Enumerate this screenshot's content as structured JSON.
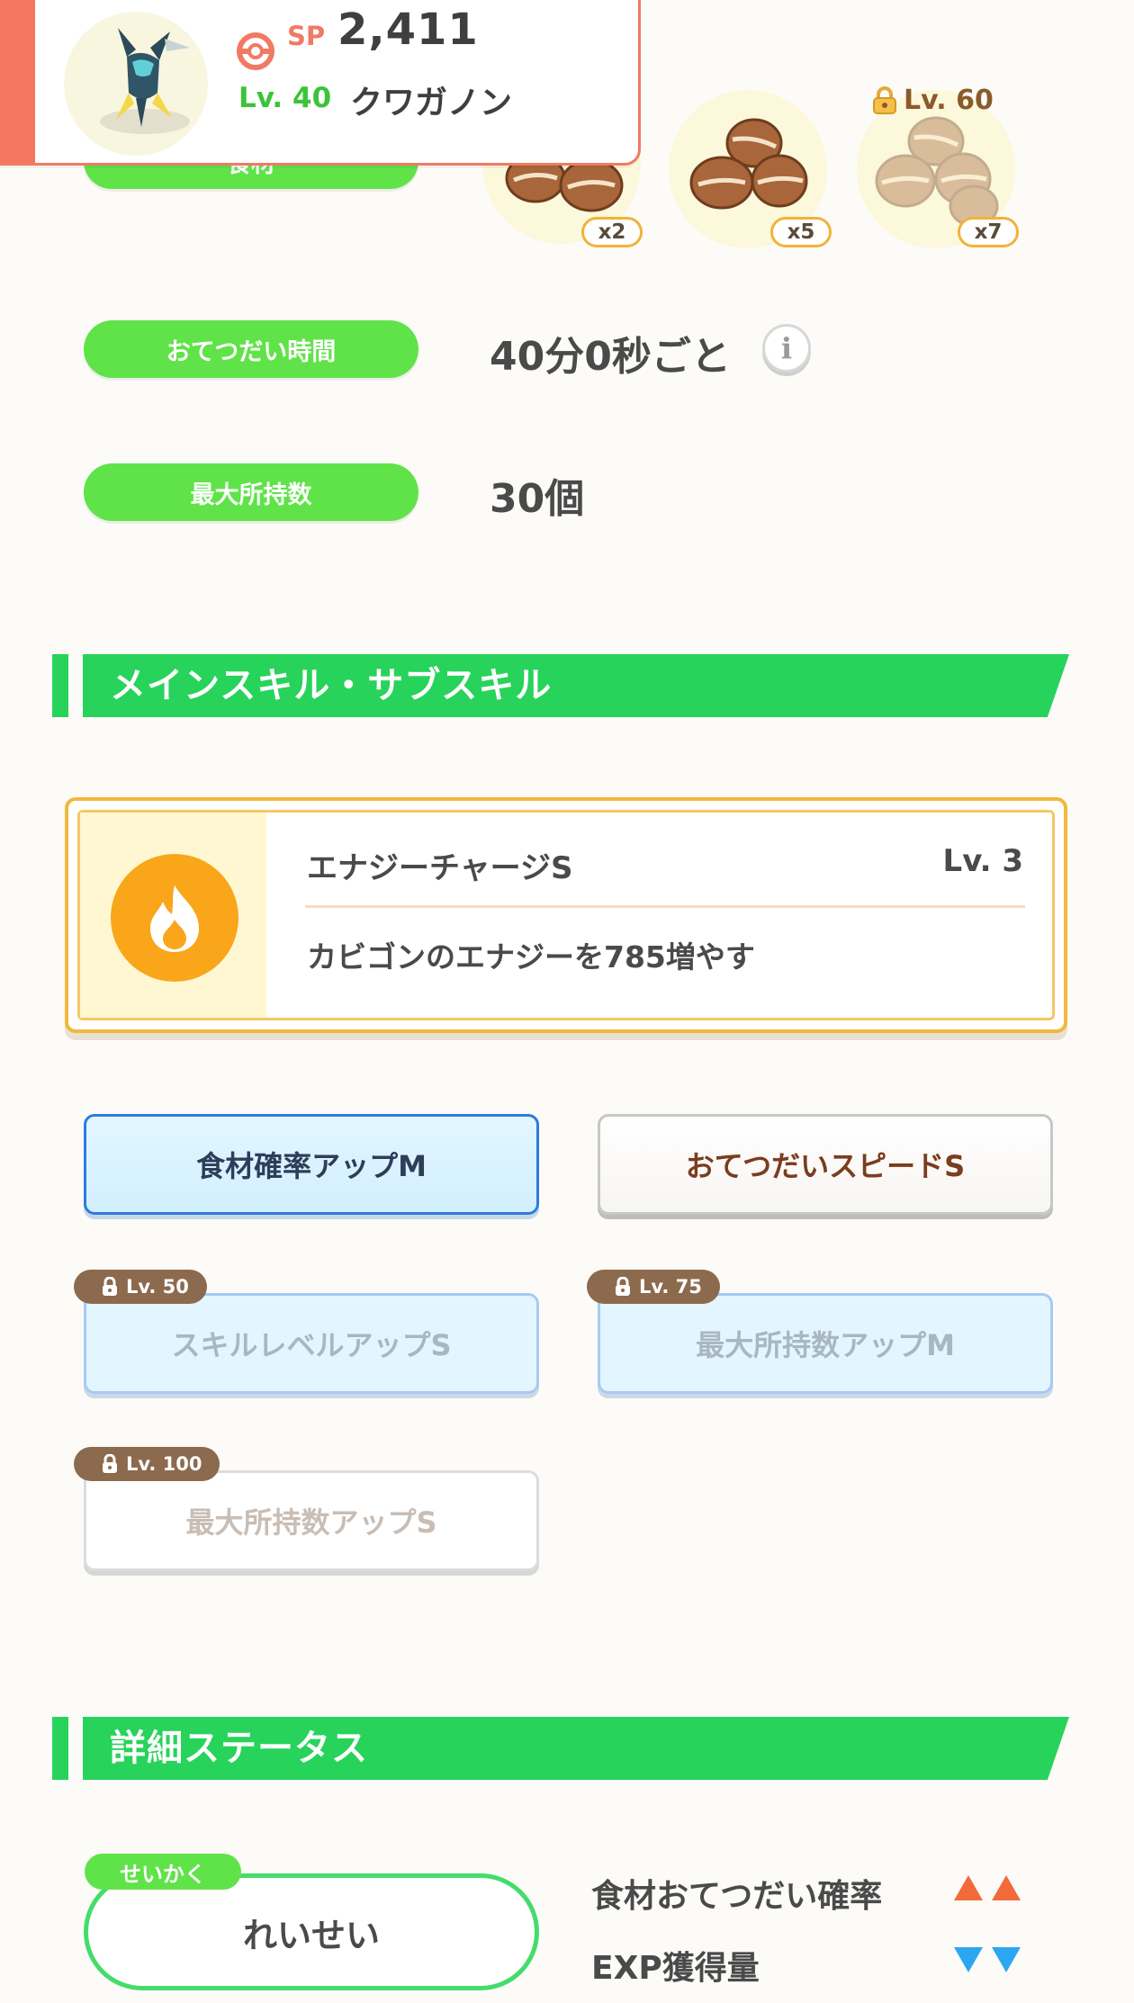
{
  "header": {
    "sp_label": "SP",
    "sp_value": "2,411",
    "level": "Lv. 40",
    "pokemon_name": "クワガノン",
    "accent_color": "#f4765f"
  },
  "ingredients": {
    "label": "食材",
    "items": [
      {
        "qty": "x2",
        "locked": false
      },
      {
        "qty": "x5",
        "locked": false
      },
      {
        "qty": "x7",
        "locked": true,
        "unlock_level": "Lv. 60"
      }
    ]
  },
  "help_time": {
    "label": "おてつだい時間",
    "value": "40分0秒ごと",
    "info_icon": "info-icon"
  },
  "max_carry": {
    "label": "最大所持数",
    "value": "30個"
  },
  "skills_section": {
    "title": "メインスキル・サブスキル",
    "main_skill": {
      "name": "エナジーチャージS",
      "level": "Lv. 3",
      "description": "カビゴンのエナジーを785増やす",
      "icon": "fire-icon"
    },
    "sub_skills": [
      {
        "label": "食材確率アップM",
        "style": "blue",
        "locked": false
      },
      {
        "label": "おてつだいスピードS",
        "style": "white",
        "locked": false
      },
      {
        "label": "スキルレベルアップS",
        "style": "blue",
        "locked": true,
        "unlock_level": "Lv. 50"
      },
      {
        "label": "最大所持数アップM",
        "style": "blue",
        "locked": true,
        "unlock_level": "Lv. 75"
      },
      {
        "label": "最大所持数アップS",
        "style": "white",
        "locked": true,
        "unlock_level": "Lv. 100"
      }
    ]
  },
  "details_section": {
    "title": "詳細ステータス",
    "nature_tag": "せいかく",
    "nature": "れいせい",
    "effects": [
      {
        "label": "食材おてつだい確率",
        "direction": "up",
        "color": "#f36a3a"
      },
      {
        "label": "EXP獲得量",
        "direction": "down",
        "color": "#2aa7f0"
      }
    ]
  }
}
